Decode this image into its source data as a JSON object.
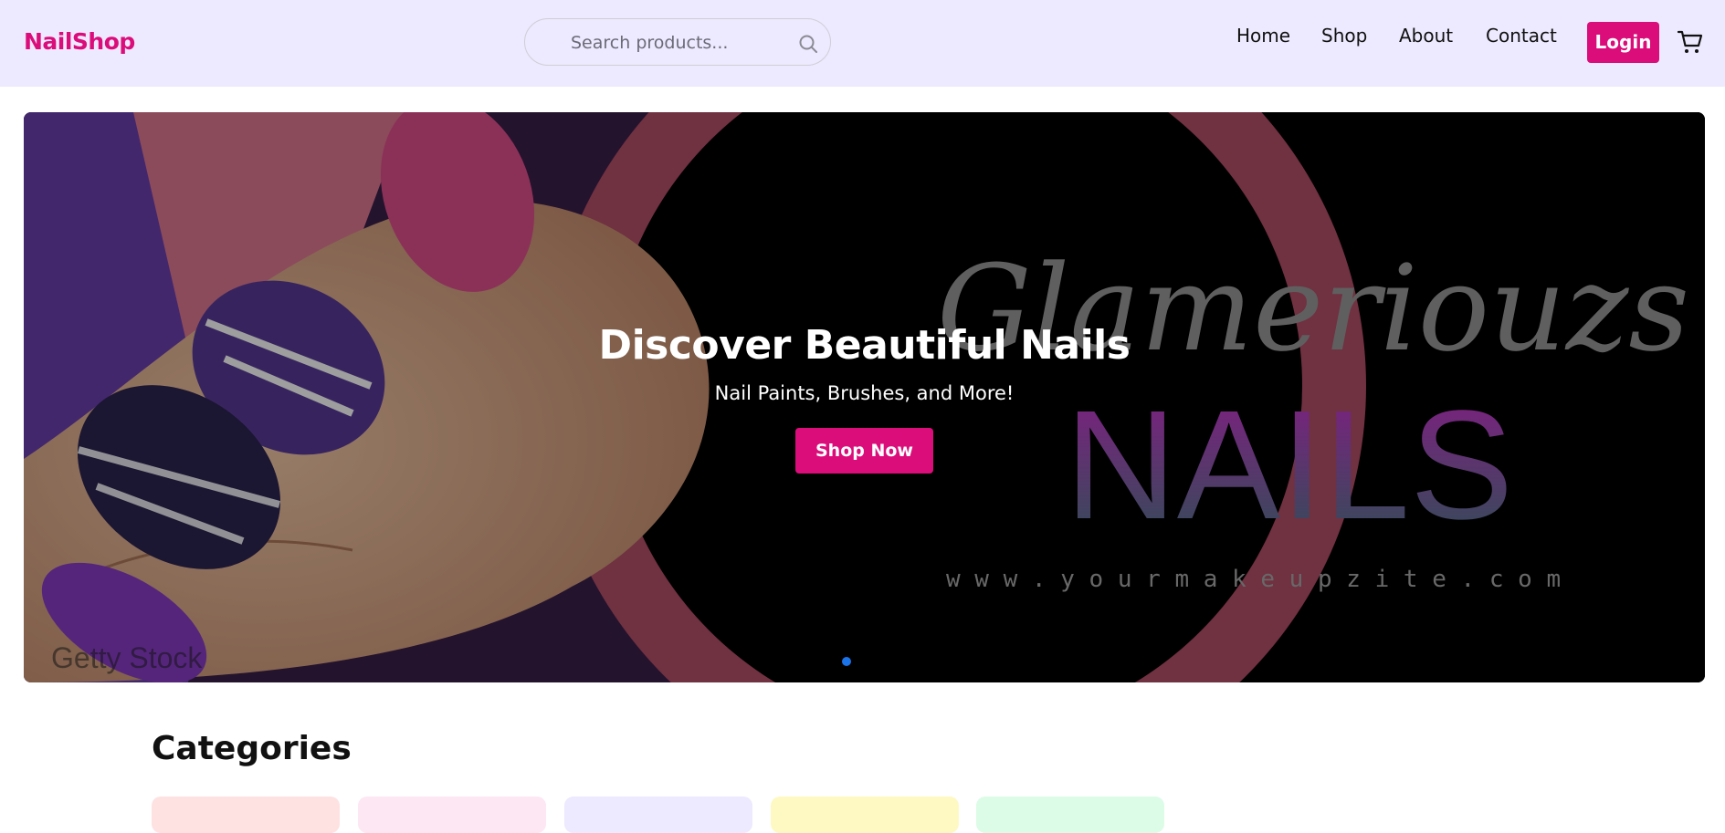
{
  "brand": {
    "name": "NailShop",
    "color": "#db0d7a"
  },
  "search": {
    "placeholder": "Search products...",
    "value": "",
    "icon": "search-icon"
  },
  "nav": {
    "links": [
      {
        "label": "Home"
      },
      {
        "label": "Shop"
      },
      {
        "label": "About"
      },
      {
        "label": "Contact"
      }
    ],
    "login_label": "Login",
    "cart_icon": "cart-icon"
  },
  "hero": {
    "title": "Discover Beautiful Nails",
    "subtitle": "Nail Paints, Brushes, and More!",
    "cta_label": "Shop Now",
    "image_text": {
      "script": "Glameriouzs",
      "nails": "NAILS",
      "url": "w w w . y o u r m a k e u p z i t e . c o m",
      "watermark": "Getty Stock"
    },
    "slide_indicator_color": "#1a73e8"
  },
  "categories": {
    "title": "Categories",
    "card_colors": [
      "#fee2e2",
      "#fce7f3",
      "#ede9fe",
      "#fef9c3",
      "#dcfce7"
    ]
  },
  "colors": {
    "navbar_bg": "#ede9fe",
    "accent": "#db0d7a"
  }
}
